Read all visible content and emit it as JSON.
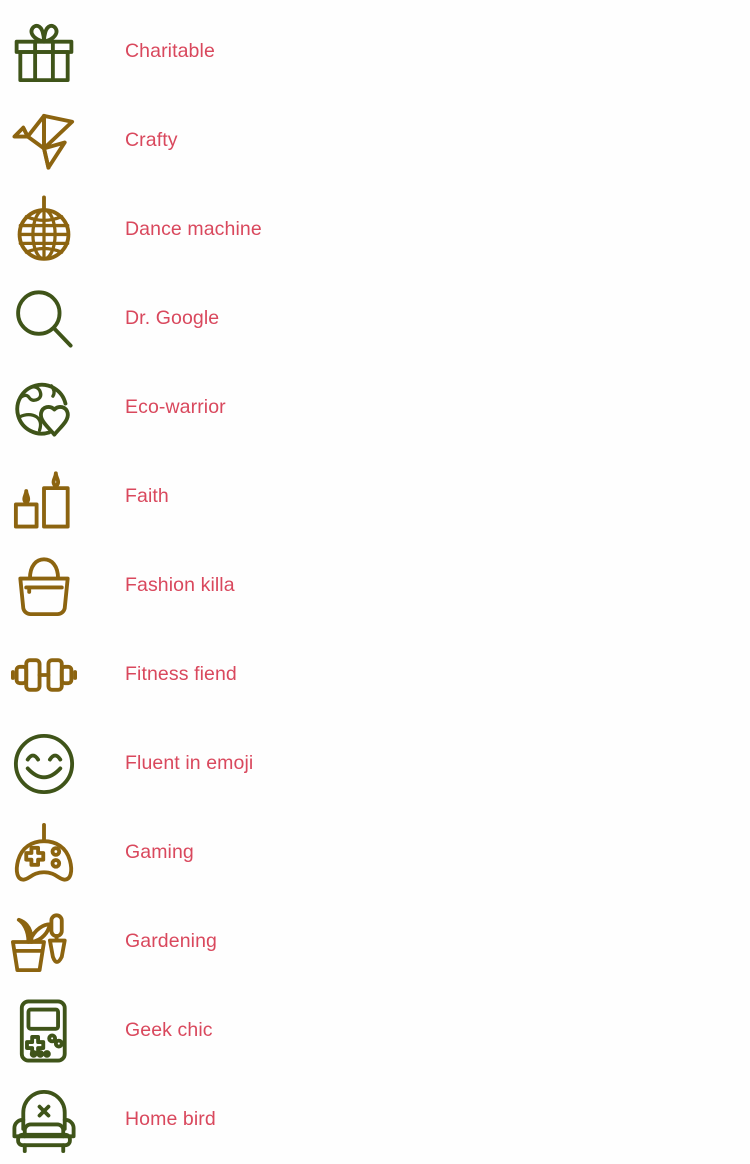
{
  "page": {
    "background_color": "#fefefe",
    "label_color": "#d9485d",
    "icon_color_green": "#3f5419",
    "icon_color_gold": "#8c6410"
  },
  "list": {
    "items": [
      {
        "label": "Charitable",
        "icon": "gift-icon",
        "color": "#3f5419"
      },
      {
        "label": "Crafty",
        "icon": "origami-bird-icon",
        "color": "#8c6410"
      },
      {
        "label": "Dance machine",
        "icon": "disco-ball-icon",
        "color": "#8c6410"
      },
      {
        "label": "Dr. Google",
        "icon": "magnifier-icon",
        "color": "#3f5419"
      },
      {
        "label": "Eco-warrior",
        "icon": "globe-heart-icon",
        "color": "#3f5419"
      },
      {
        "label": "Faith",
        "icon": "candles-icon",
        "color": "#8c6410"
      },
      {
        "label": "Fashion killa",
        "icon": "handbag-icon",
        "color": "#8c6410"
      },
      {
        "label": "Fitness fiend",
        "icon": "dumbbell-icon",
        "color": "#8c6410"
      },
      {
        "label": "Fluent in emoji",
        "icon": "smiley-face-icon",
        "color": "#3f5419"
      },
      {
        "label": "Gaming",
        "icon": "gamepad-icon",
        "color": "#8c6410"
      },
      {
        "label": "Gardening",
        "icon": "plant-trowel-icon",
        "color": "#8c6410"
      },
      {
        "label": "Geek chic",
        "icon": "handheld-console-icon",
        "color": "#3f5419"
      },
      {
        "label": "Home bird",
        "icon": "armchair-icon",
        "color": "#3f5419"
      }
    ]
  }
}
